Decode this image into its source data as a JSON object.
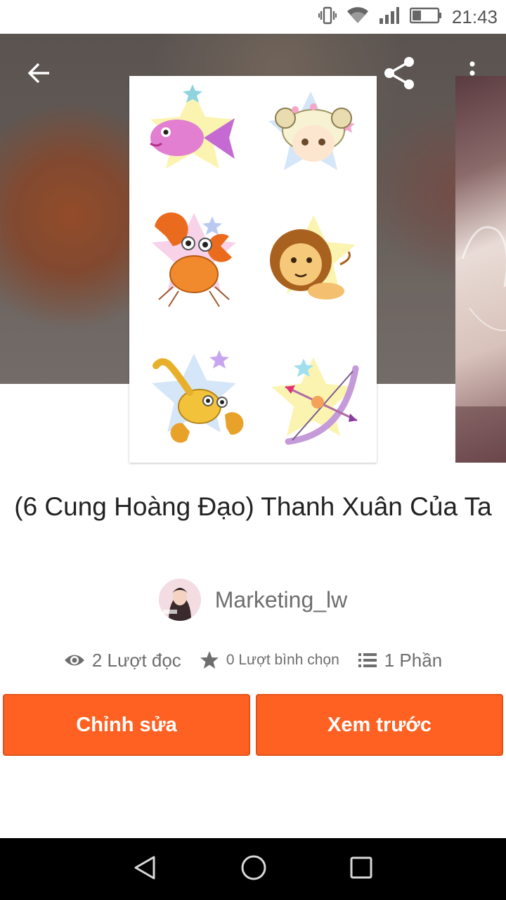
{
  "status_bar": {
    "time": "21:43",
    "icons": [
      "vibrate-icon",
      "wifi-icon",
      "signal-icon",
      "battery-icon"
    ]
  },
  "toolbar": {
    "back_icon": "back-arrow-icon",
    "share_icon": "share-icon",
    "more_icon": "more-vert-icon"
  },
  "story": {
    "title": "(6 Cung Hoàng Đạo) Thanh Xuân Của Ta",
    "author": "Marketing_lw",
    "stats": {
      "reads": "2 Lượt đọc",
      "votes": "0 Lượt bình chọn",
      "parts": "1 Phần"
    }
  },
  "actions": {
    "edit": "Chỉnh sửa",
    "preview": "Xem trước"
  },
  "colors": {
    "accent": "#ff6122",
    "text_primary": "#222222",
    "text_secondary": "#6e6e6e"
  },
  "nav_bar": [
    "back-triangle-icon",
    "home-circle-icon",
    "recents-square-icon"
  ]
}
